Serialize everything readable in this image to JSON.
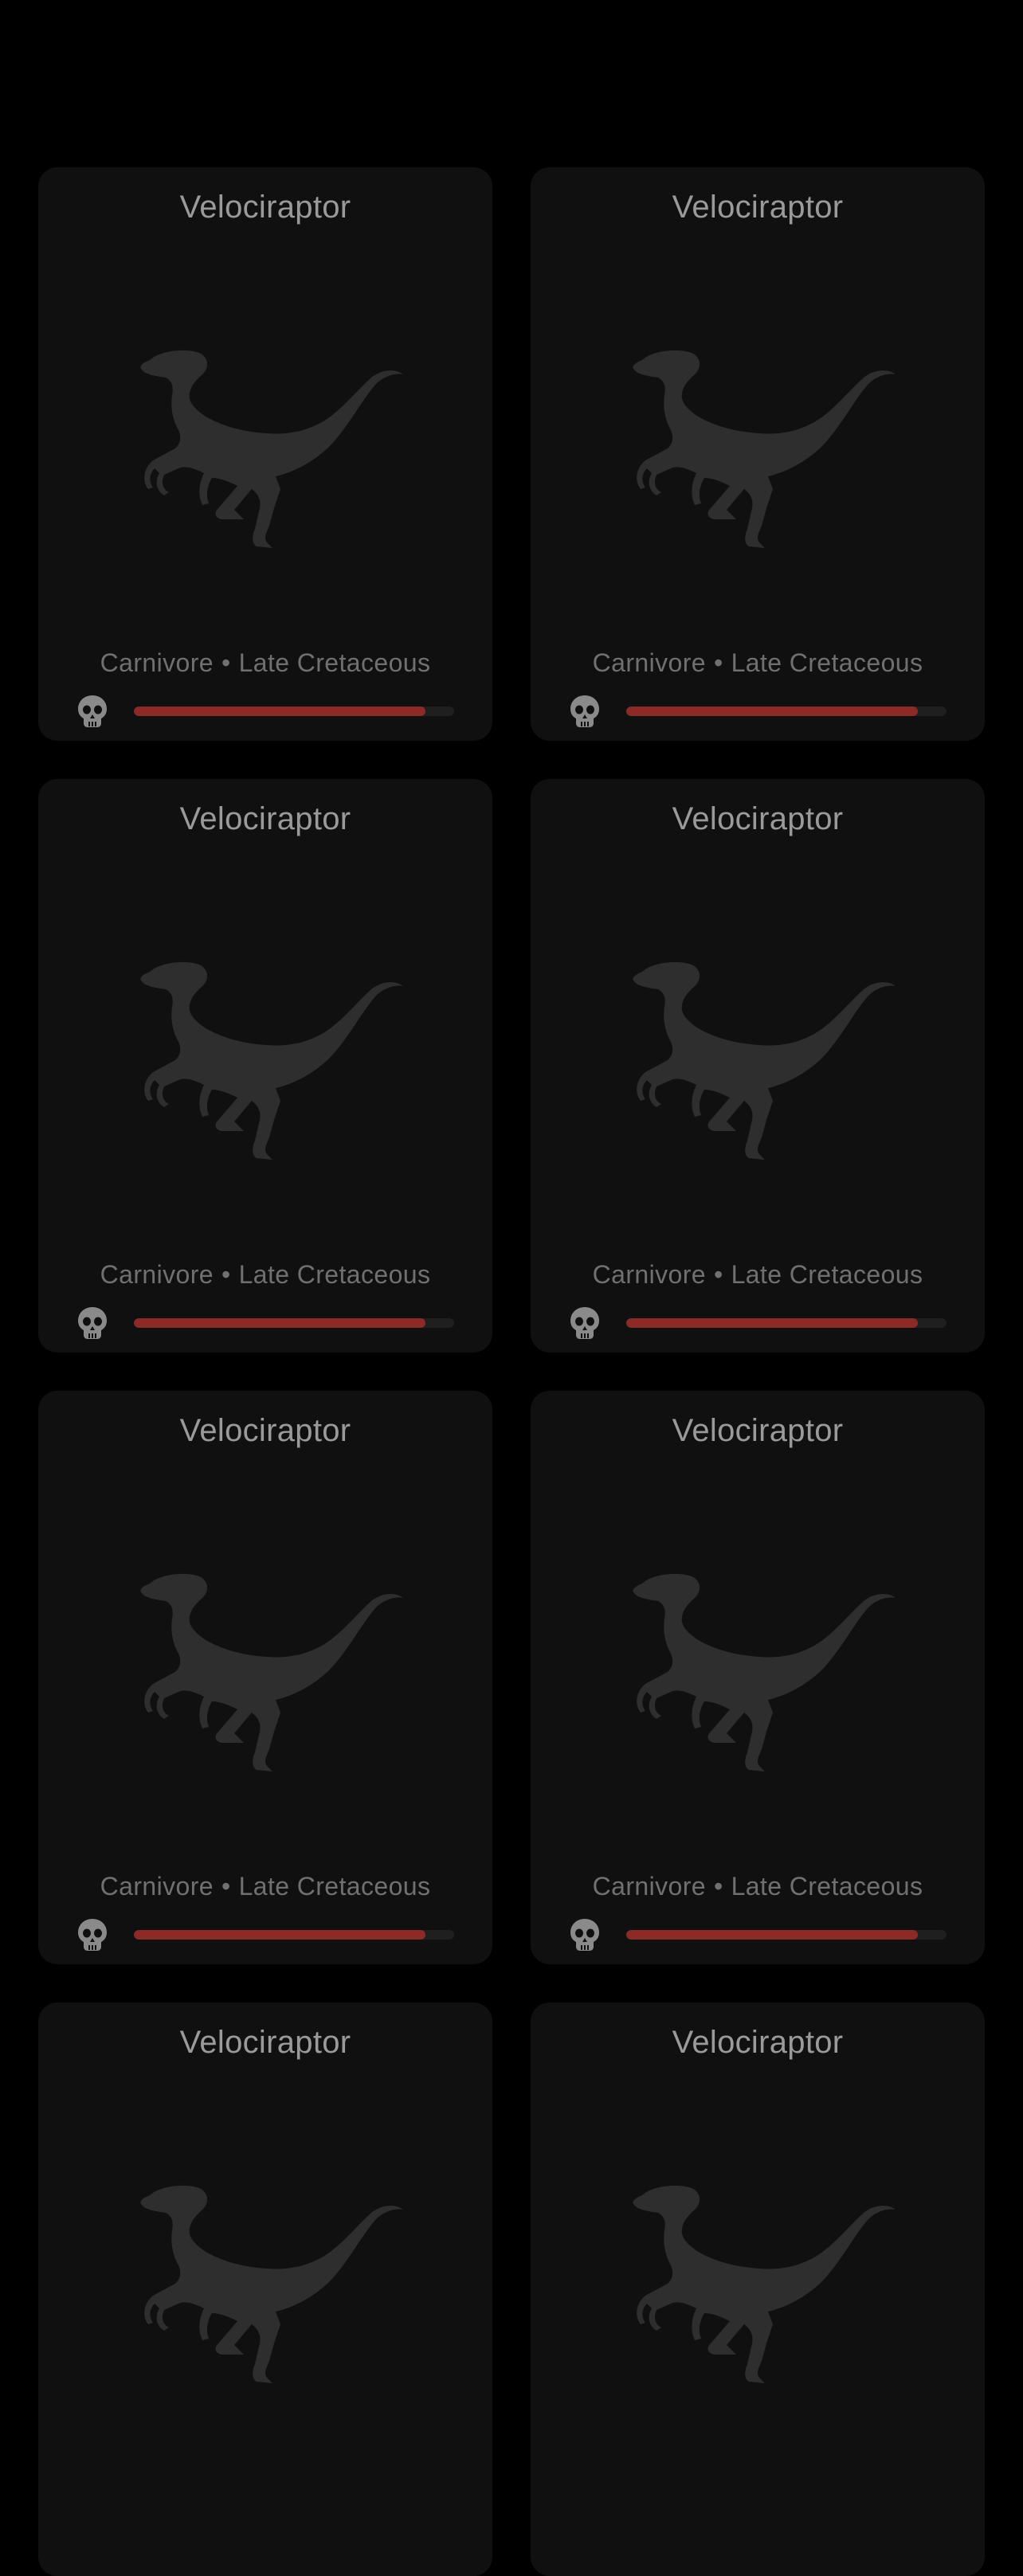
{
  "colors": {
    "background": "#000000",
    "card": "#101010",
    "title_text": "#9a9a9a",
    "subtitle_text": "#707070",
    "silhouette": "#2e2e2e",
    "bar_track": "#1f1f1f",
    "bar_fill": "#8c2a28"
  },
  "cards": [
    {
      "title": "Velociraptor",
      "diet": "Carnivore",
      "separator": "•",
      "period": "Late Cretaceous",
      "icon": "skull-icon",
      "threat_fraction": 0.91
    },
    {
      "title": "Velociraptor",
      "diet": "Carnivore",
      "separator": "•",
      "period": "Late Cretaceous",
      "icon": "skull-icon",
      "threat_fraction": 0.91
    },
    {
      "title": "Velociraptor",
      "diet": "Carnivore",
      "separator": "•",
      "period": "Late Cretaceous",
      "icon": "skull-icon",
      "threat_fraction": 0.91
    },
    {
      "title": "Velociraptor",
      "diet": "Carnivore",
      "separator": "•",
      "period": "Late Cretaceous",
      "icon": "skull-icon",
      "threat_fraction": 0.91
    },
    {
      "title": "Velociraptor",
      "diet": "Carnivore",
      "separator": "•",
      "period": "Late Cretaceous",
      "icon": "skull-icon",
      "threat_fraction": 0.91
    },
    {
      "title": "Velociraptor",
      "diet": "Carnivore",
      "separator": "•",
      "period": "Late Cretaceous",
      "icon": "skull-icon",
      "threat_fraction": 0.91
    },
    {
      "title": "Velociraptor",
      "icon": "dinosaur-silhouette"
    },
    {
      "title": "Velociraptor",
      "icon": "dinosaur-silhouette"
    }
  ]
}
